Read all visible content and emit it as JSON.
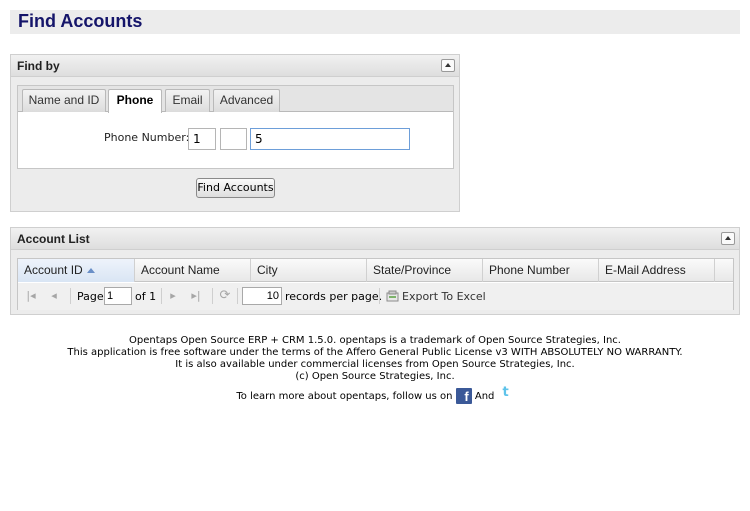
{
  "page": {
    "title": "Find Accounts"
  },
  "find_by": {
    "header": "Find by",
    "tabs": [
      {
        "label": "Name and ID",
        "active": false
      },
      {
        "label": "Phone",
        "active": true
      },
      {
        "label": "Email",
        "active": false
      },
      {
        "label": "Advanced",
        "active": false
      }
    ],
    "phone": {
      "label": "Phone Number:",
      "country_code": "1",
      "area_code": "",
      "number": "5"
    },
    "submit_label": "Find Accounts"
  },
  "account_list": {
    "header": "Account List",
    "columns": [
      {
        "label": "Account ID",
        "sorted": "asc"
      },
      {
        "label": "Account Name"
      },
      {
        "label": "City"
      },
      {
        "label": "State/Province"
      },
      {
        "label": "Phone Number"
      },
      {
        "label": "E-Mail Address"
      }
    ],
    "paging": {
      "page_label": "Page",
      "page_value": "1",
      "of_label": "of 1",
      "records_value": "10",
      "records_label": "records per page.",
      "export_label": "Export To Excel"
    }
  },
  "footer": {
    "line1": "Opentaps Open Source ERP + CRM 1.5.0. opentaps is a trademark of Open Source Strategies, Inc.",
    "line2": "This application is free software under the terms of the Affero General Public License v3 WITH ABSOLUTELY NO WARRANTY.",
    "line3": "It is also available under commercial licenses from Open Source Strategies, Inc.",
    "line4": "(c) Open Source Strategies, Inc.",
    "follow_text": "To learn more about opentaps, follow us on",
    "and_text": "And"
  },
  "colors": {
    "title": "#15156a",
    "facebook": "#3b5998",
    "twitter": "#5ec3ea",
    "focus_border": "#6d9ed9"
  }
}
